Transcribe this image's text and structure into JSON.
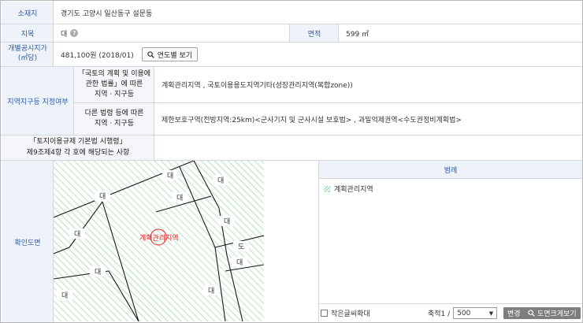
{
  "rows": {
    "location": {
      "label": "소재지",
      "value": "경기도 고양시 일산동구 설문동"
    },
    "category": {
      "label": "지목",
      "value": "대",
      "help": "?"
    },
    "area": {
      "label": "면적",
      "value": "599 ㎡"
    },
    "price": {
      "label": "개별공시지가",
      "label2": "(㎡당)",
      "value": "481,100원 (2018/01)",
      "button": "연도별 보기"
    }
  },
  "zoning": {
    "label": "지역지구등 지정여부",
    "law1": {
      "label_l1": "「국토의 계획 및 이용에",
      "label_l2": "관한 법률」에 따른",
      "label_l3": "지역 · 지구등",
      "value": "계획관리지역 , 국토이용용도지역기타(성장관리지역(복합zone))"
    },
    "law2": {
      "label_l1": "다른 법령 등에 따른",
      "label_l2": "지역 · 지구등",
      "value": "제한보호구역(전방지역:25km)<군사기지 및 군사시설 보호법> , 과밀억제권역<수도권정비계획법>"
    },
    "decree": {
      "label_l1": "「토지이용규제 기본법 시행령」",
      "label_l2": "제9조제4항 각 호에 해당되는 사항",
      "value": ""
    }
  },
  "map_section": {
    "label": "확인도면",
    "parcel_label": "계획관리지역",
    "lot_labels": [
      "대",
      "대",
      "대",
      "대",
      "대",
      "대",
      "대",
      "대",
      "대",
      "대",
      "도"
    ],
    "legend_title": "범례",
    "legend_items": [
      {
        "name": "계획관리지역",
        "color": "#7fcf8f"
      }
    ]
  },
  "controls": {
    "small_text": "작은글씨확대",
    "scale_label": "축적1 /",
    "scale_value": "500",
    "change": "변경",
    "enlarge": "도면크게보기"
  }
}
